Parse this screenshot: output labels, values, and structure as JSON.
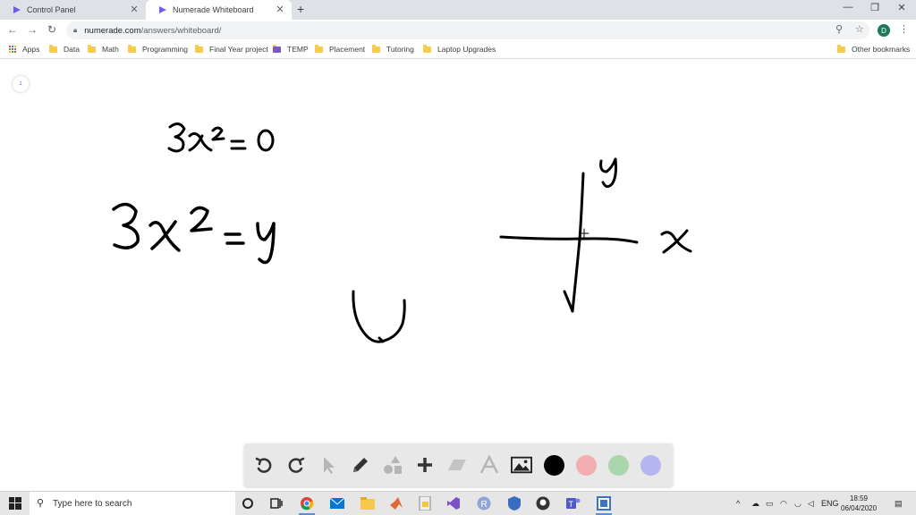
{
  "browser": {
    "tabs": [
      {
        "title": "Control Panel",
        "active": false
      },
      {
        "title": "Numerade Whiteboard",
        "active": true
      }
    ],
    "address": {
      "host": "numerade.com",
      "path": "/answers/whiteboard/"
    },
    "profile_initial": "D",
    "bookmarks": [
      "Apps",
      "Data",
      "Math",
      "Programming",
      "Final Year project",
      "TEMP",
      "Placement",
      "Tutoring",
      "Laptop Upgrades"
    ],
    "other_bookmarks": "Other bookmarks"
  },
  "whiteboard": {
    "page_indicator": "1",
    "tools": [
      "undo-icon",
      "redo-icon",
      "select-arrow-icon",
      "pen-icon",
      "shapes-icon",
      "add-plus-icon",
      "eraser-icon",
      "text-icon",
      "image-icon"
    ],
    "colors": [
      "#000000",
      "#f2aeb0",
      "#a9d6aa",
      "#b5b5f0"
    ]
  },
  "taskbar": {
    "search_placeholder": "Type here to search",
    "language": "ENG",
    "time": "18:59",
    "date": "06/04/2020"
  }
}
